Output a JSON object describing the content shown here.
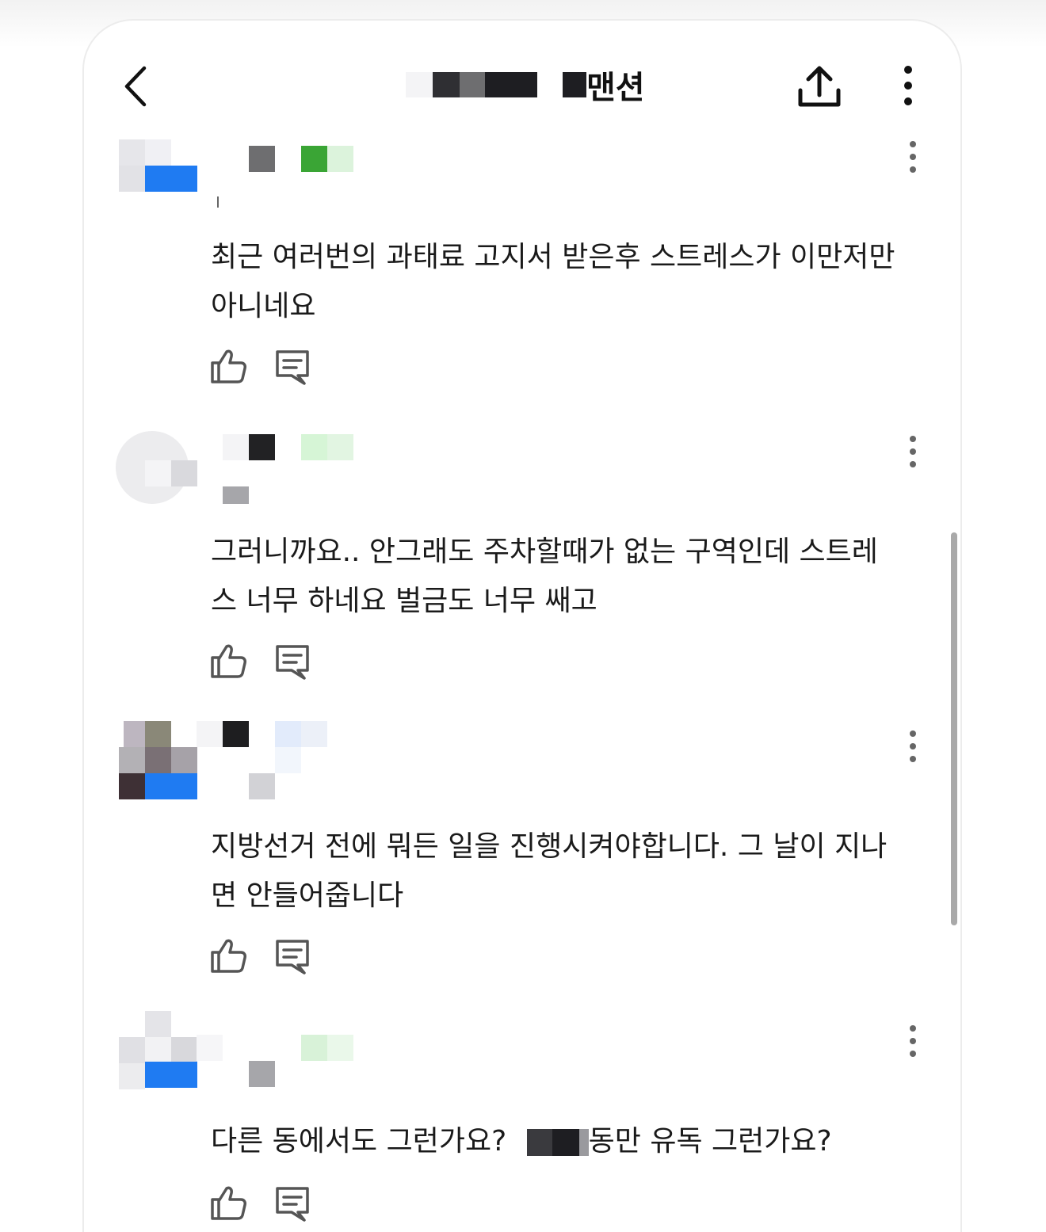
{
  "header": {
    "title": "맨션",
    "back_icon": "chevron-left-icon",
    "share_icon": "share-upload-icon",
    "more_icon": "vertical-ellipsis-icon"
  },
  "comments": [
    {
      "text": "최근 여러번의 과태료 고지서 받은후 스트레스가 이만저만\n아니네요",
      "actions": [
        "thumbs-up-icon",
        "reply-icon"
      ]
    },
    {
      "text": "그러니까요.. 안그래도 주차할때가 없는 구역인데 스트레\n스 너무 하네요 벌금도 너무 쌔고",
      "actions": [
        "thumbs-up-icon",
        "reply-icon"
      ]
    },
    {
      "text": "지방선거 전에 뭐든 일을 진행시켜야합니다. 그 날이 지나\n면 안들어줍니다",
      "actions": [
        "thumbs-up-icon",
        "reply-icon"
      ]
    },
    {
      "text_before": "다른 동에서도 그런가요?",
      "text_after": "동만 유독 그런가요?",
      "actions": [
        "thumbs-up-icon",
        "reply-icon"
      ]
    }
  ],
  "colors": {
    "text": "#1a1a1a",
    "icon": "#555555",
    "scrollbar": "#a9a9a9",
    "badge_blue": "#1f7bf2",
    "badge_green": "#3aa535"
  }
}
